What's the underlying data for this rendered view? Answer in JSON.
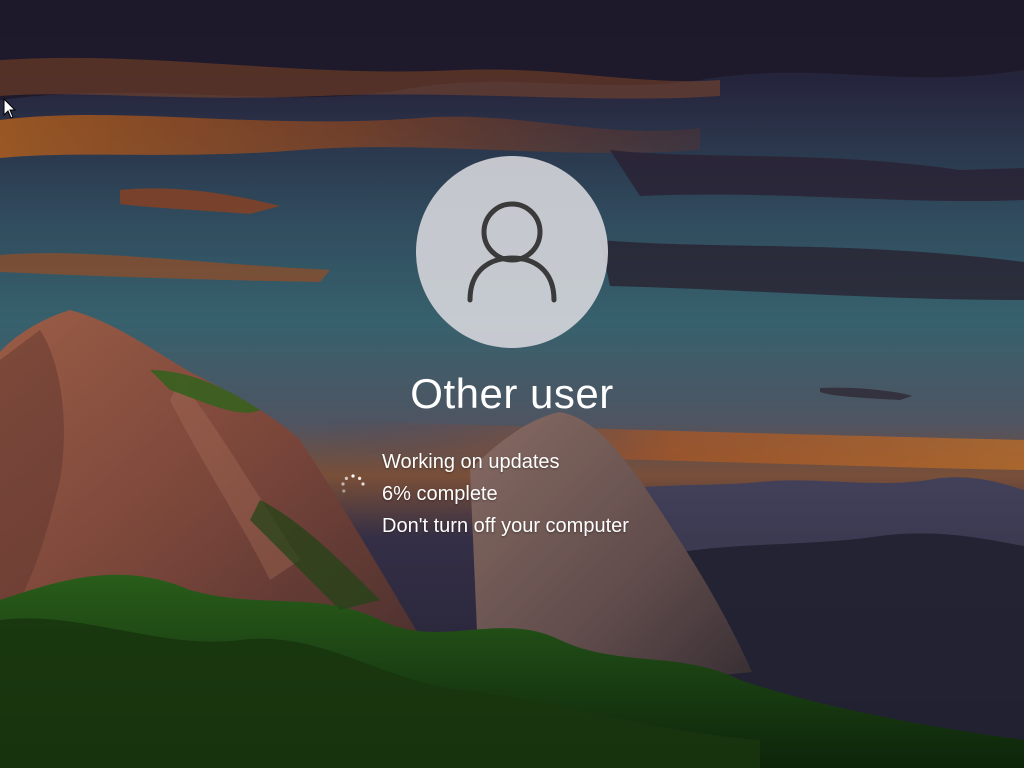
{
  "lock_screen": {
    "user_name": "Other user",
    "avatar_icon": "user-silhouette-icon"
  },
  "update_status": {
    "title": "Working on updates",
    "progress_percent": 6,
    "progress_text": "6% complete",
    "warning": "Don't turn off your computer",
    "spinner_icon": "loading-spinner-icon"
  },
  "colors": {
    "avatar_fill": "#dadade",
    "avatar_icon": "#3a3a3a",
    "text": "#ffffff"
  }
}
